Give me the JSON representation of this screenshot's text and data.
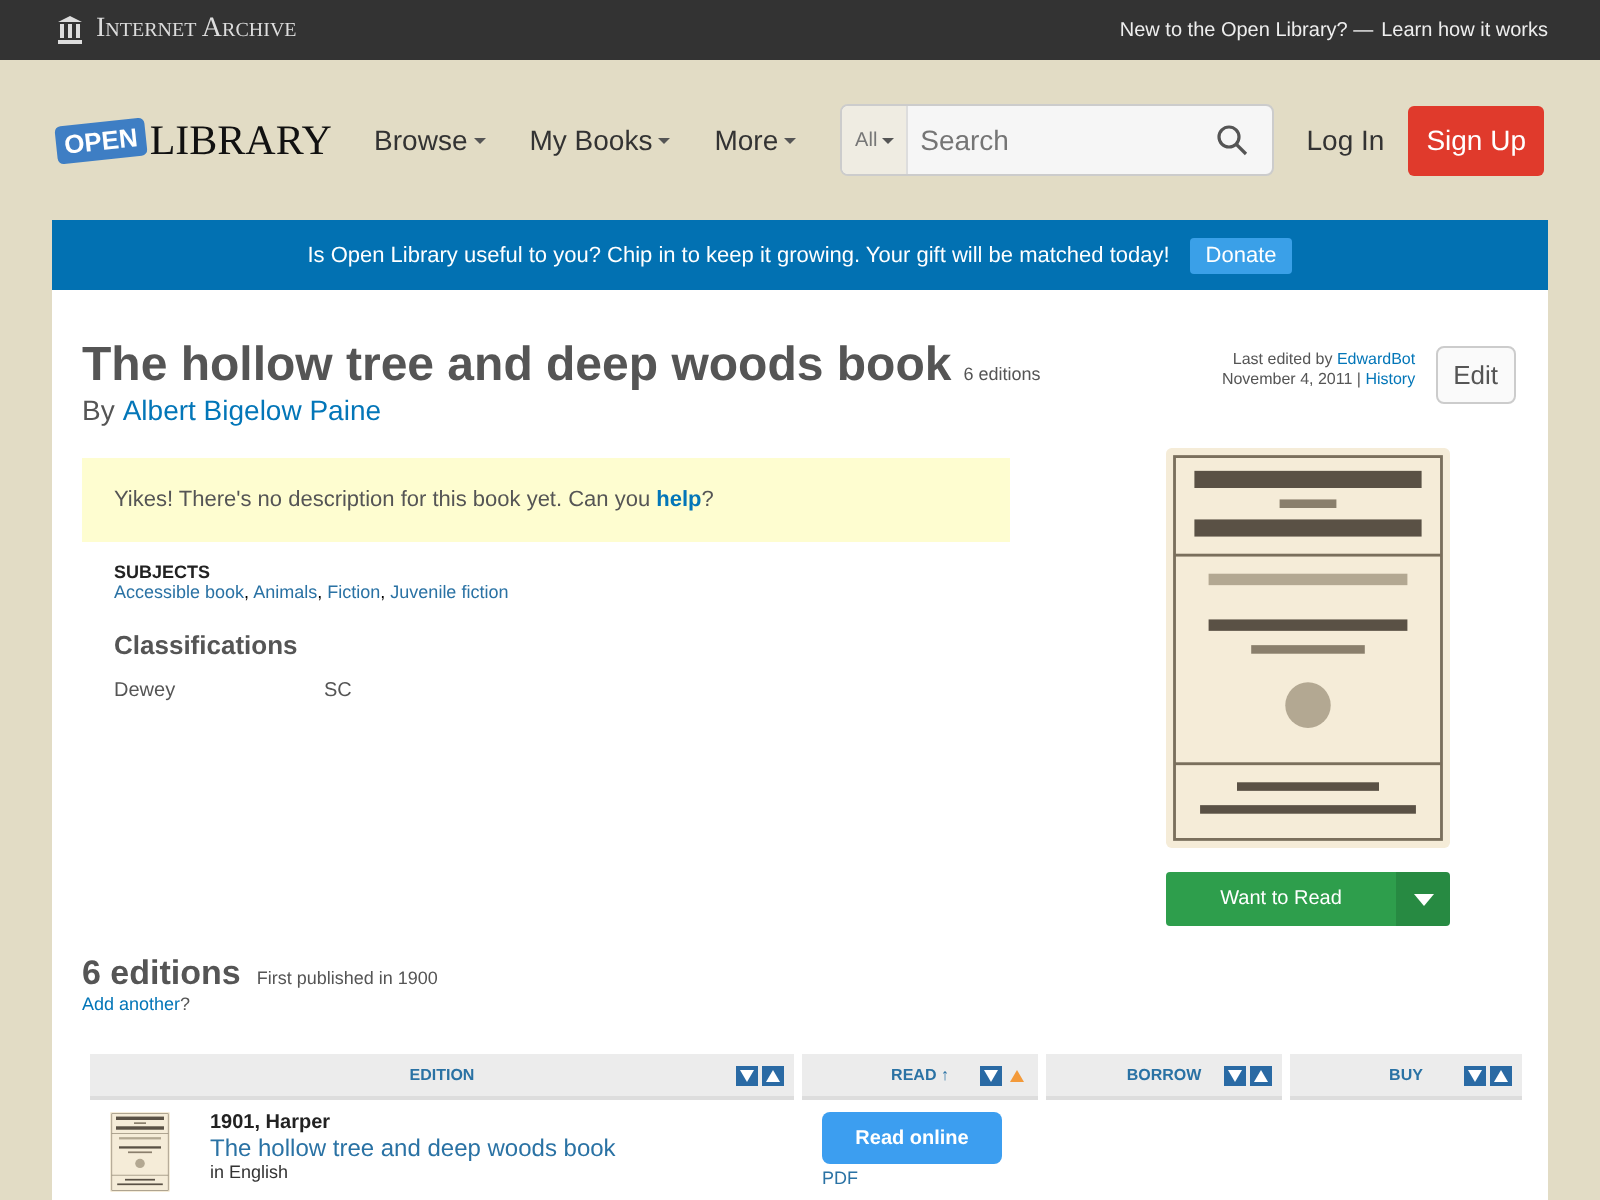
{
  "topbar": {
    "brand": "Internet Archive",
    "prompt": "New to the Open Library? —",
    "link": "Learn how it works"
  },
  "header": {
    "logo_badge": "OPEN",
    "logo_text": "LIBRARY",
    "nav": [
      "Browse",
      "My Books",
      "More"
    ],
    "search": {
      "scope": "All",
      "placeholder": "Search"
    },
    "login": "Log In",
    "signup": "Sign Up"
  },
  "banner": {
    "text": "Is Open Library useful to you? Chip in to keep it growing. Your gift will be matched today!",
    "button": "Donate"
  },
  "work": {
    "title": "The hollow tree and deep woods book",
    "editions_count": "6 editions",
    "by": "By",
    "author": "Albert Bigelow Paine",
    "edited_prefix": "Last edited by",
    "editor": "EdwardBot",
    "edited_date": "November 4, 2011 |",
    "history": "History",
    "edit": "Edit",
    "notice": "Yikes! There's no description for this book yet. Can you",
    "notice_link": "help",
    "notice_end": "?",
    "subjects_label": "SUBJECTS",
    "subjects_separator": ",",
    "subjects": [
      "Accessible book",
      "Animals",
      "Fiction",
      "Juvenile fiction"
    ],
    "classifications_title": "Classifications",
    "classifications": [
      {
        "label": "Dewey",
        "value": "SC"
      }
    ],
    "want": "Want to Read"
  },
  "editions": {
    "title": "6 editions",
    "first": "First published in 1900",
    "add": "Add another",
    "add_end": "?",
    "columns": [
      {
        "label": "EDITION",
        "sorted": false
      },
      {
        "label": "READ ↑",
        "sorted": true
      },
      {
        "label": "BORROW",
        "sorted": false
      },
      {
        "label": "BUY",
        "sorted": false
      }
    ],
    "rows": [
      {
        "pub": "1901, Harper",
        "title": "The hollow tree and deep woods book",
        "lang": "in English",
        "read": "Read online",
        "format": "PDF"
      }
    ]
  }
}
